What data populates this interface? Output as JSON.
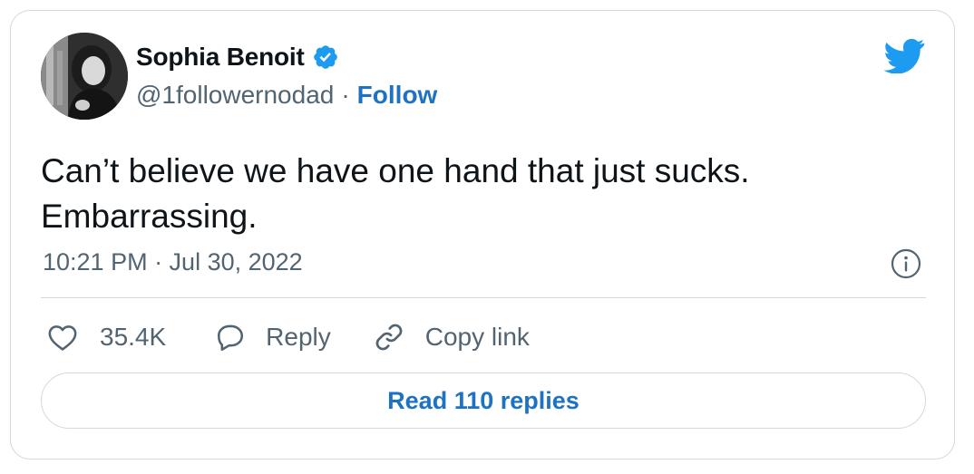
{
  "author": {
    "display_name": "Sophia Benoit",
    "handle": "@1followernodad",
    "separator": "·",
    "follow_label": "Follow",
    "verified": true
  },
  "tweet": {
    "text": "Can’t believe we have one hand that just sucks. Embarrassing.",
    "timestamp": "10:21 PM · Jul 30, 2022"
  },
  "actions": {
    "like_count": "35.4K",
    "reply_label": "Reply",
    "copy_link_label": "Copy link"
  },
  "footer": {
    "read_replies_label": "Read 110 replies"
  },
  "icons": {
    "brand": "twitter-bird-icon",
    "verified": "verified-badge-icon",
    "info": "info-icon",
    "like": "heart-icon",
    "reply": "speech-bubble-icon",
    "copy_link": "link-icon"
  },
  "colors": {
    "brand_blue": "#1d9bf0",
    "link_blue": "#1d72c4",
    "text_primary": "#0f1419",
    "text_secondary": "#536471",
    "border": "#cfd9de"
  }
}
